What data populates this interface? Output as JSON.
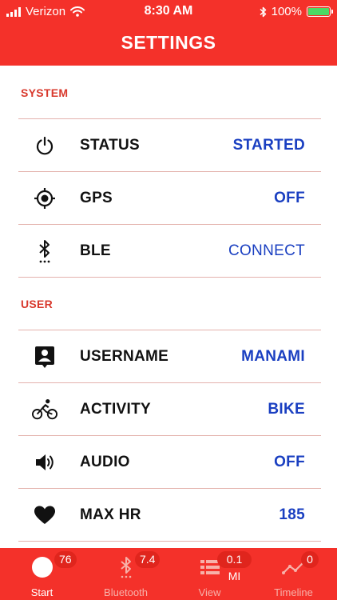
{
  "status_bar": {
    "carrier": "Verizon",
    "time": "8:30 AM",
    "battery_percent": "100%",
    "battery_color": "#4cd964"
  },
  "header": {
    "title": "SETTINGS"
  },
  "sections": {
    "system": {
      "title": "SYSTEM",
      "rows": [
        {
          "label": "STATUS",
          "value": "STARTED",
          "icon": "power-icon"
        },
        {
          "label": "GPS",
          "value": "OFF",
          "icon": "gps-target-icon"
        },
        {
          "label": "BLE",
          "value": "CONNECT",
          "icon": "bluetooth-icon"
        }
      ]
    },
    "user": {
      "title": "USER",
      "rows": [
        {
          "label": "USERNAME",
          "value": "MANAMI",
          "icon": "contact-badge-icon"
        },
        {
          "label": "ACTIVITY",
          "value": "BIKE",
          "icon": "bicycle-icon"
        },
        {
          "label": "AUDIO",
          "value": "OFF",
          "icon": "speaker-icon"
        },
        {
          "label": "MAX HR",
          "value": "185",
          "icon": "heart-icon"
        }
      ]
    }
  },
  "tabs": [
    {
      "label": "Start",
      "badge": "76",
      "icon": "circle-icon",
      "active": true
    },
    {
      "label": "Bluetooth",
      "badge": "7.4",
      "icon": "bluetooth-icon",
      "active": false
    },
    {
      "label": "View",
      "badge": "0.1 MI",
      "icon": "list-view-icon",
      "active": false
    },
    {
      "label": "Timeline",
      "badge": "0",
      "icon": "line-chart-icon",
      "active": false
    }
  ],
  "colors": {
    "brand_red": "#f4312a",
    "section_header": "#d8382c",
    "value_blue": "#1a3fc1",
    "divider": "#e3b2ad"
  }
}
